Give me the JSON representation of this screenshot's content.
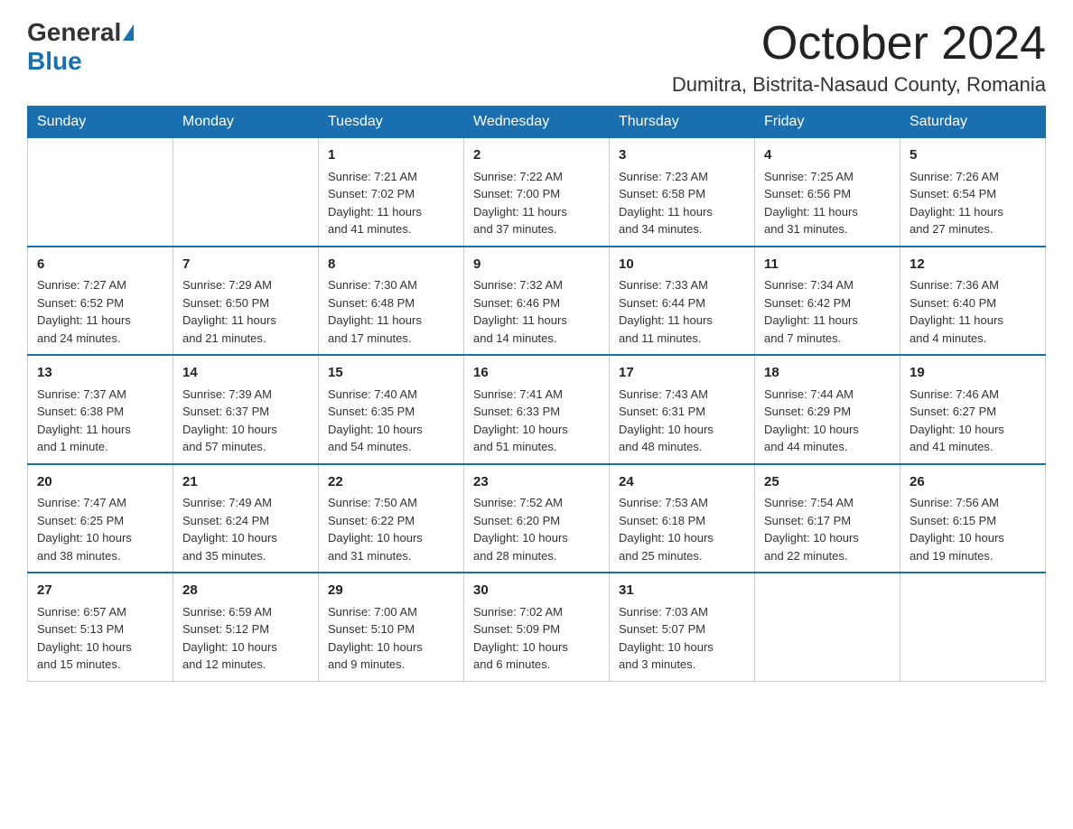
{
  "logo": {
    "general": "General",
    "blue": "Blue"
  },
  "title": "October 2024",
  "location": "Dumitra, Bistrita-Nasaud County, Romania",
  "days": [
    "Sunday",
    "Monday",
    "Tuesday",
    "Wednesday",
    "Thursday",
    "Friday",
    "Saturday"
  ],
  "weeks": [
    [
      {
        "num": "",
        "info": ""
      },
      {
        "num": "",
        "info": ""
      },
      {
        "num": "1",
        "info": "Sunrise: 7:21 AM\nSunset: 7:02 PM\nDaylight: 11 hours\nand 41 minutes."
      },
      {
        "num": "2",
        "info": "Sunrise: 7:22 AM\nSunset: 7:00 PM\nDaylight: 11 hours\nand 37 minutes."
      },
      {
        "num": "3",
        "info": "Sunrise: 7:23 AM\nSunset: 6:58 PM\nDaylight: 11 hours\nand 34 minutes."
      },
      {
        "num": "4",
        "info": "Sunrise: 7:25 AM\nSunset: 6:56 PM\nDaylight: 11 hours\nand 31 minutes."
      },
      {
        "num": "5",
        "info": "Sunrise: 7:26 AM\nSunset: 6:54 PM\nDaylight: 11 hours\nand 27 minutes."
      }
    ],
    [
      {
        "num": "6",
        "info": "Sunrise: 7:27 AM\nSunset: 6:52 PM\nDaylight: 11 hours\nand 24 minutes."
      },
      {
        "num": "7",
        "info": "Sunrise: 7:29 AM\nSunset: 6:50 PM\nDaylight: 11 hours\nand 21 minutes."
      },
      {
        "num": "8",
        "info": "Sunrise: 7:30 AM\nSunset: 6:48 PM\nDaylight: 11 hours\nand 17 minutes."
      },
      {
        "num": "9",
        "info": "Sunrise: 7:32 AM\nSunset: 6:46 PM\nDaylight: 11 hours\nand 14 minutes."
      },
      {
        "num": "10",
        "info": "Sunrise: 7:33 AM\nSunset: 6:44 PM\nDaylight: 11 hours\nand 11 minutes."
      },
      {
        "num": "11",
        "info": "Sunrise: 7:34 AM\nSunset: 6:42 PM\nDaylight: 11 hours\nand 7 minutes."
      },
      {
        "num": "12",
        "info": "Sunrise: 7:36 AM\nSunset: 6:40 PM\nDaylight: 11 hours\nand 4 minutes."
      }
    ],
    [
      {
        "num": "13",
        "info": "Sunrise: 7:37 AM\nSunset: 6:38 PM\nDaylight: 11 hours\nand 1 minute."
      },
      {
        "num": "14",
        "info": "Sunrise: 7:39 AM\nSunset: 6:37 PM\nDaylight: 10 hours\nand 57 minutes."
      },
      {
        "num": "15",
        "info": "Sunrise: 7:40 AM\nSunset: 6:35 PM\nDaylight: 10 hours\nand 54 minutes."
      },
      {
        "num": "16",
        "info": "Sunrise: 7:41 AM\nSunset: 6:33 PM\nDaylight: 10 hours\nand 51 minutes."
      },
      {
        "num": "17",
        "info": "Sunrise: 7:43 AM\nSunset: 6:31 PM\nDaylight: 10 hours\nand 48 minutes."
      },
      {
        "num": "18",
        "info": "Sunrise: 7:44 AM\nSunset: 6:29 PM\nDaylight: 10 hours\nand 44 minutes."
      },
      {
        "num": "19",
        "info": "Sunrise: 7:46 AM\nSunset: 6:27 PM\nDaylight: 10 hours\nand 41 minutes."
      }
    ],
    [
      {
        "num": "20",
        "info": "Sunrise: 7:47 AM\nSunset: 6:25 PM\nDaylight: 10 hours\nand 38 minutes."
      },
      {
        "num": "21",
        "info": "Sunrise: 7:49 AM\nSunset: 6:24 PM\nDaylight: 10 hours\nand 35 minutes."
      },
      {
        "num": "22",
        "info": "Sunrise: 7:50 AM\nSunset: 6:22 PM\nDaylight: 10 hours\nand 31 minutes."
      },
      {
        "num": "23",
        "info": "Sunrise: 7:52 AM\nSunset: 6:20 PM\nDaylight: 10 hours\nand 28 minutes."
      },
      {
        "num": "24",
        "info": "Sunrise: 7:53 AM\nSunset: 6:18 PM\nDaylight: 10 hours\nand 25 minutes."
      },
      {
        "num": "25",
        "info": "Sunrise: 7:54 AM\nSunset: 6:17 PM\nDaylight: 10 hours\nand 22 minutes."
      },
      {
        "num": "26",
        "info": "Sunrise: 7:56 AM\nSunset: 6:15 PM\nDaylight: 10 hours\nand 19 minutes."
      }
    ],
    [
      {
        "num": "27",
        "info": "Sunrise: 6:57 AM\nSunset: 5:13 PM\nDaylight: 10 hours\nand 15 minutes."
      },
      {
        "num": "28",
        "info": "Sunrise: 6:59 AM\nSunset: 5:12 PM\nDaylight: 10 hours\nand 12 minutes."
      },
      {
        "num": "29",
        "info": "Sunrise: 7:00 AM\nSunset: 5:10 PM\nDaylight: 10 hours\nand 9 minutes."
      },
      {
        "num": "30",
        "info": "Sunrise: 7:02 AM\nSunset: 5:09 PM\nDaylight: 10 hours\nand 6 minutes."
      },
      {
        "num": "31",
        "info": "Sunrise: 7:03 AM\nSunset: 5:07 PM\nDaylight: 10 hours\nand 3 minutes."
      },
      {
        "num": "",
        "info": ""
      },
      {
        "num": "",
        "info": ""
      }
    ]
  ]
}
